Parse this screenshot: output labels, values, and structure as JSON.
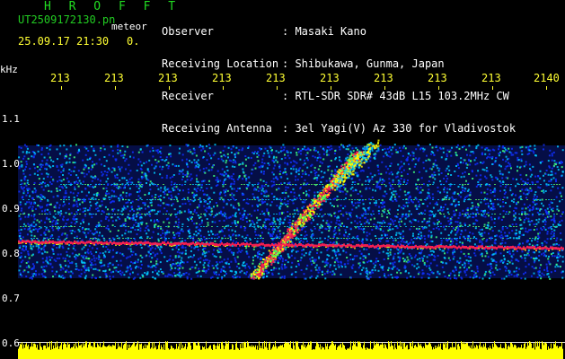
{
  "header": {
    "app_title": "H R O F F T",
    "file_name": "UT2509172130.pn",
    "file_suffix": "meteor",
    "datetime": "25.09.17 21:30",
    "flag": "0.",
    "info_labels": [
      "Observer",
      "Receiving Location",
      "Receiver",
      "Receiving Antenna"
    ],
    "info_values": [
      ": Masaki Kano",
      ": Shibukawa, Gunma, Japan",
      ": RTL-SDR SDR# 43dB L15 103.2MHz CW",
      ": 3el Yagi(V) Az 330 for Vladivostok"
    ]
  },
  "axis": {
    "unit": "kHz",
    "y_labels": [
      "1.1",
      "1.0",
      "0.9",
      "0.8",
      "0.7",
      "0.6"
    ],
    "time_ticks": [
      "213",
      "213",
      "213",
      "213",
      "213",
      "213",
      "213",
      "213",
      "213",
      "2140"
    ]
  },
  "colors": {
    "background": "#000000",
    "noise_blue": "#1030ff",
    "noise_cyan": "#00c8ff",
    "echo_red": "#ff2050",
    "echo_yellow": "#ffff00",
    "bottom_plot": "#ffff00",
    "tick_text": "#ffff33",
    "title_green": "#22dd22"
  }
}
